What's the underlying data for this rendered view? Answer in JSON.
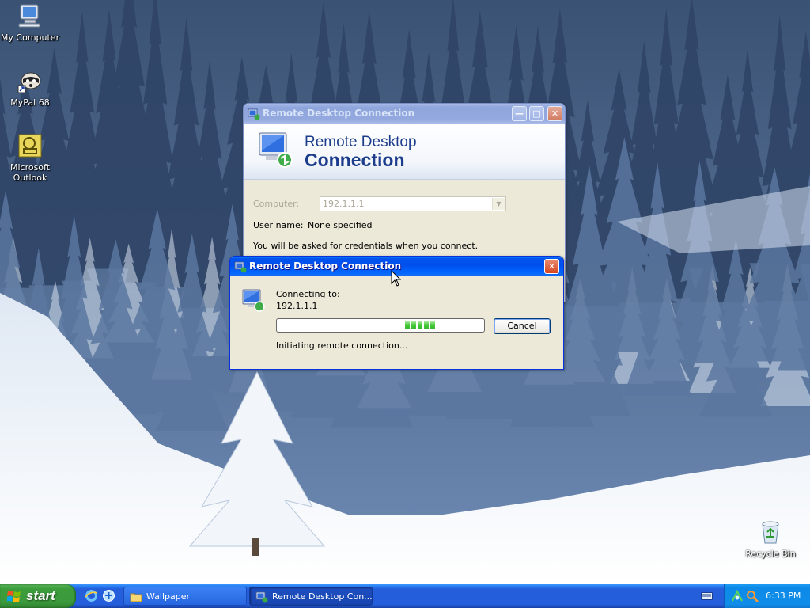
{
  "desktop": {
    "icons": [
      {
        "label": "My Computer"
      },
      {
        "label": "MyPal 68"
      },
      {
        "label": "Microsoft Outlook"
      },
      {
        "label": "Recycle Bin"
      }
    ]
  },
  "rdc_main": {
    "title": "Remote Desktop Connection",
    "banner_line1": "Remote Desktop",
    "banner_line2": "Connection",
    "computer_label": "Computer:",
    "computer_value": "192.1.1.1",
    "username_label": "User name:",
    "username_value": "None specified",
    "credentials_note": "You will be asked for credentials when you connect."
  },
  "rdc_dialog": {
    "title": "Remote Desktop Connection",
    "connecting_label": "Connecting to:",
    "host": "192.1.1.1",
    "status": "Initiating remote connection...",
    "cancel_label": "Cancel",
    "progress_fraction": 0.7
  },
  "taskbar": {
    "start_label": "start",
    "tasks": [
      {
        "label": "Wallpaper"
      },
      {
        "label": "Remote Desktop Con..."
      }
    ],
    "clock": "6:33 PM"
  },
  "colors": {
    "titlebar_active": "#0054e3",
    "taskbar": "#245edb",
    "start_green": "#3c9d3c",
    "tray": "#0f8de9",
    "progress_green": "#31b42a"
  }
}
